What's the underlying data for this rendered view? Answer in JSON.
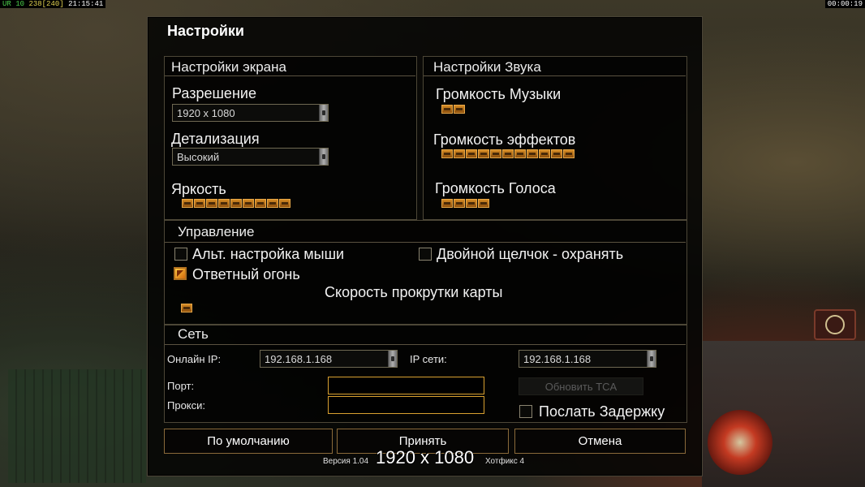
{
  "top_bar": {
    "left_prefix": "UR",
    "left_ping": "10",
    "left_fps": "238",
    "left_fps_bracket": "[240]",
    "left_clock": "21:15:41",
    "right_timer": "00:00:19"
  },
  "dialog": {
    "title": "Настройки"
  },
  "screen": {
    "header": "Настройки экрана",
    "resolution_label": "Разрешение",
    "resolution_value": "1920 x 1080",
    "detail_label": "Детализация",
    "detail_value": "Высокий",
    "brightness_label": "Яркость",
    "brightness_level": 9
  },
  "sound": {
    "header": "Настройки Звука",
    "music_label": "Громкость Музыки",
    "music_level": 2,
    "effects_label": "Громкость эффектов",
    "effects_level": 11,
    "voice_label": "Громкость Голоса",
    "voice_level": 4
  },
  "controls": {
    "header": "Управление",
    "alt_mouse_label": "Альт. настройка мыши",
    "alt_mouse_checked": false,
    "double_click_label": "Двойной щелчок - охранять",
    "double_click_checked": false,
    "retaliation_label": "Ответный огонь",
    "retaliation_checked": true,
    "scroll_speed_label": "Скорость прокрутки карты",
    "scroll_speed_level": 1
  },
  "network": {
    "header": "Сеть",
    "online_ip_label": "Онлайн IP:",
    "online_ip_value": "192.168.1.168",
    "lan_ip_label": "IP сети:",
    "lan_ip_value": "192.168.1.168",
    "port_label": "Порт:",
    "port_value": "",
    "proxy_label": "Прокси:",
    "proxy_value": "",
    "update_tca_label": "Обновить TCA",
    "send_delay_label": "Послать Задержку",
    "send_delay_checked": false
  },
  "buttons": {
    "defaults": "По умолчанию",
    "accept": "Принять",
    "cancel": "Отмена"
  },
  "footer": {
    "version_text": "Версия 1.04",
    "version_suffix": "Хотфикс 4",
    "resolution_overlay": "1920 x 1080"
  },
  "colors": {
    "slider_segment": "#d48a24",
    "checkbox_checked": "#f0a020",
    "textbox_border": "#d8a030",
    "button_border": "#8a6a3a"
  }
}
